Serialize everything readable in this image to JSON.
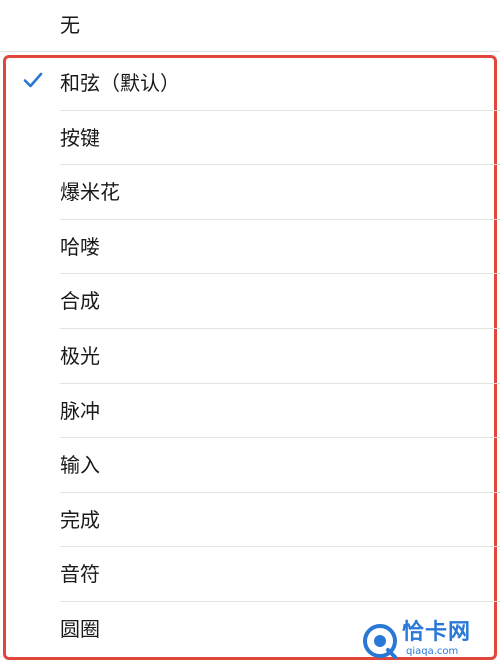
{
  "top_option": {
    "label": "无"
  },
  "options": [
    {
      "label": "和弦（默认）",
      "selected": true
    },
    {
      "label": "按键",
      "selected": false
    },
    {
      "label": "爆米花",
      "selected": false
    },
    {
      "label": "哈喽",
      "selected": false
    },
    {
      "label": "合成",
      "selected": false
    },
    {
      "label": "极光",
      "selected": false
    },
    {
      "label": "脉冲",
      "selected": false
    },
    {
      "label": "输入",
      "selected": false
    },
    {
      "label": "完成",
      "selected": false
    },
    {
      "label": "音符",
      "selected": false
    },
    {
      "label": "圆圈",
      "selected": false
    }
  ],
  "colors": {
    "checkmark": "#2a78d6",
    "highlight_border": "#e1473a",
    "divider": "#e2e2e2"
  },
  "watermark": {
    "brand": "恰卡网",
    "domain": "qiaqa.com",
    "icon": "brand-logo-icon"
  }
}
